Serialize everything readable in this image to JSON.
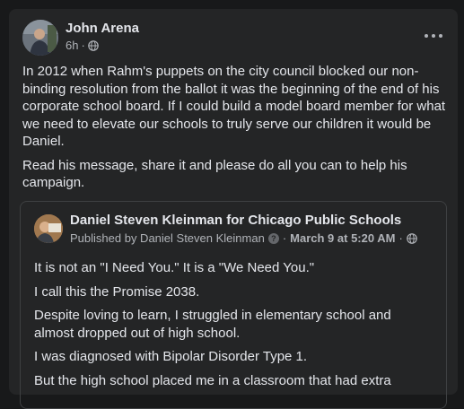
{
  "post": {
    "author": "John Arena",
    "time": "6h",
    "audience_icon": "globe-icon",
    "paragraphs": [
      "In 2012 when Rahm's puppets on the city council blocked our non-binding resolution from the ballot it was the beginning of the end of his corporate school board. If I could build a model board member for what we need to elevate our schools to truly serve our children it would be Daniel.",
      "Read his message, share it and please do all you can to help his campaign."
    ]
  },
  "shared": {
    "page_name": "Daniel Steven Kleinman for Chicago Public Schools",
    "published_by": "Published by Daniel Steven Kleinman",
    "date": "March 9 at 5:20 AM",
    "paragraphs": [
      "It is not an \"I Need You.\"  It is a \"We Need You.\"",
      "I call this the Promise 2038.",
      "Despite loving to learn, I struggled in elementary school and almost dropped out of high school.",
      "I was diagnosed with Bipolar Disorder Type 1.",
      "But the high school placed me in a classroom that had extra"
    ]
  },
  "colors": {
    "background": "#18191a",
    "card": "#242526",
    "primary_text": "#e4e6eb",
    "secondary_text": "#b0b3b8"
  }
}
